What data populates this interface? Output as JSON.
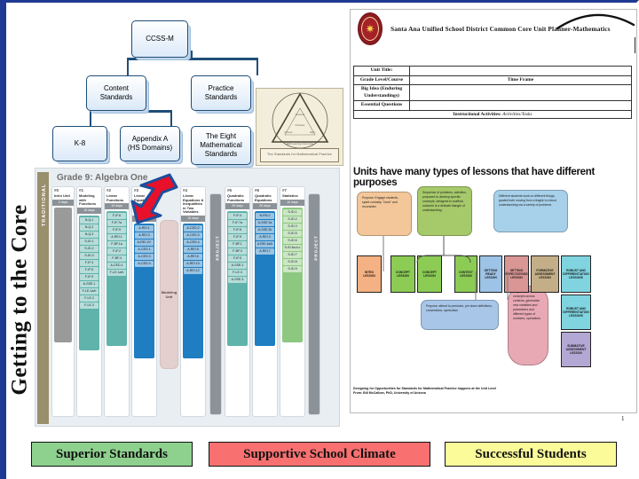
{
  "slide": {
    "core_label": "Getting to the Core"
  },
  "hierarchy": {
    "nodes": [
      {
        "label": "CCSS-M"
      },
      {
        "label": "Content\nStandards"
      },
      {
        "label": "Practice\nStandards"
      },
      {
        "label": "K-8"
      },
      {
        "label": "Appendix A\n(HS Domains)"
      },
      {
        "label": "The Eight\nMathematical\nStandards"
      }
    ]
  },
  "triangle_logo": {
    "caption": "The Standards for Mathematical Practice",
    "inner_labels": [
      "Content",
      "Practices",
      "Process",
      "Proficiency",
      "Math Learning Community"
    ]
  },
  "pathway": {
    "track_label": "TRADITIONAL",
    "title": "Grade 9: Algebra One",
    "columns": [
      {
        "num": "#0",
        "name": "Intro Unit",
        "days": "3 days",
        "color": "#9a9a9a",
        "cells": []
      },
      {
        "num": "#1",
        "name": "Modeling with Functions",
        "days": "15 days",
        "color": "#5fb3ab",
        "cells": [
          "N-Q.1",
          "N-Q.2",
          "N-Q.3",
          "S-ID.1",
          "S-ID.2",
          "S-ID.3",
          "F-IF.4",
          "F-IF.5",
          "F-IF.9",
          "A-SSE.1",
          "F-LE.1a/b",
          "F-LE.2",
          "F-LE.3"
        ]
      },
      {
        "num": "#2",
        "name": "Linear Functions",
        "days": "15 days",
        "color": "#5fb3ab",
        "cells": [
          "F-IF.6",
          "F-IF.7a",
          "F-IF.9",
          "A-REI.1",
          "F-BF.1a",
          "F-IF.2",
          "F-BF.4",
          "A-CED.1",
          "F-LE.1a/b"
        ]
      },
      {
        "num": "#3",
        "name": "Linear Equations & Inequalities in One Variable",
        "days": "15 days",
        "color": "#1f7dc2",
        "cells": [
          "A-REI.1",
          "A-REI.3",
          "A-REI.11*",
          "A-CED.1",
          "A-CED.3",
          "A-CED.4"
        ]
      },
      {
        "num": "",
        "name": "Modeling Unit",
        "days": "4 days",
        "color": "#e3cfcd",
        "cells": []
      },
      {
        "num": "#4",
        "name": "Linear Equations & Inequalities in Two Variables",
        "days": "15 days",
        "color": "#1f7dc2",
        "cells": [
          "A-CED.2",
          "A-CED.3",
          "A-CED.4",
          "A-REI.5",
          "A-REI.6",
          "A-REI.10",
          "A-REI.12"
        ]
      },
      {
        "num": "P",
        "name": "PROJECT",
        "days": "5 days",
        "color": "#8c9398",
        "cells": []
      },
      {
        "num": "#5",
        "name": "Quadratic Functions",
        "days": "20 days",
        "color": "#5fb3ab",
        "cells": [
          "F-IF.4",
          "F-IF.7a",
          "F-IF.8",
          "F-IF.9",
          "F-BF.1",
          "F-BF.3",
          "F-IF.5",
          "A-SSE.1",
          "F-LE.3",
          "A-SSE.3"
        ]
      },
      {
        "num": "#6",
        "name": "Quadratic Equations",
        "days": "20 days",
        "color": "#1f7dc2",
        "cells": [
          "N-RN.2",
          "A-SSE.3a",
          "A-SSE.3b",
          "A-REI.4",
          "A-REI.4a/b",
          "A-REI.7"
        ]
      },
      {
        "num": "#7",
        "name": "Statistics",
        "days": "10 days",
        "color": "#8cc87f",
        "cells": [
          "S-ID.1",
          "S-ID.2",
          "S-ID.3",
          "S-ID.5",
          "S-ID.6",
          "S-ID.6a,b,c",
          "S-ID.7",
          "S-ID.8",
          "S-ID.9"
        ]
      },
      {
        "num": "P",
        "name": "PROJECT",
        "days": "5 days",
        "color": "#8c9398",
        "cells": []
      }
    ]
  },
  "document": {
    "title": "Santa Ana Unified School District Common Core Unit Planner-Mathematics",
    "page_number": "1",
    "form_rows": [
      {
        "label": "Unit Title:",
        "value": ""
      },
      {
        "label": "Grade Level/Course",
        "value": "Time Frame"
      },
      {
        "label": "Big Idea (Enduring Understandings)",
        "value": ""
      },
      {
        "label": "Essential Questions",
        "value": ""
      }
    ],
    "instructional_row": "Instructional Activities:",
    "instructional_row_italic": "Activities/Tasks",
    "purposes": {
      "title": "Units have many types of lessons that have different purposes",
      "callouts": [
        {
          "text": "Purpose: Engage students, spark curiosity, \"hook\" and reconsider",
          "color": "#f3c79a"
        },
        {
          "text": "Sequence of problems, activities, purposed to develop specific concepts, designed to scaffold, outcome is a delicate triangle of understanding",
          "color": "#a6c96a"
        },
        {
          "text": "Different students work on different things, graded both moving from a fragile to robust understanding via a variety of problems",
          "color": "#a7d0ea"
        },
        {
          "text": "Purpose: attend to precision, pin down definitions, conventions, symbolism",
          "color": "#a7c6e8"
        },
        {
          "text": "Purpose: use concepts across contexts, generalize new variables and parameters and different types of numbers, operations",
          "color": "#e8a9b4"
        }
      ],
      "lesson_boxes": [
        {
          "label": "INTRO LESSON",
          "color": "#f4b183"
        },
        {
          "label": "CONCEPT LESSON",
          "color": "#8ccc55"
        },
        {
          "label": "CONCEPT LESSON",
          "color": "#8ccc55"
        },
        {
          "label": "CONTEXT LESSON",
          "color": "#8ccc55"
        },
        {
          "label": "GETTING READY LESSON",
          "color": "#9dc3e6"
        },
        {
          "label": "SETTING EXPECTATIONS LESSON",
          "color": "#d99694"
        },
        {
          "label": "FORMATIVE ASSESSMENT LESSON",
          "color": "#c4ae87"
        },
        {
          "label": "ROBUST AND DIFFERENTIATION LESSONS",
          "color": "#7fd4e0"
        },
        {
          "label": "ROBUST AND DIFFERENTIATION LESSONS",
          "color": "#7fd4e0"
        },
        {
          "label": "SUMMATIVE ASSESSMENT LESSON",
          "color": "#b3a7d4"
        }
      ]
    },
    "credit": "Designing for Opportunities for Standards for Mathematical Practice happens at the Unit Level\nFrom: Bill McCallum, PhD, University of Arizona"
  },
  "footer": {
    "banners": [
      {
        "label": "Superior Standards",
        "color": "#8ed18e"
      },
      {
        "label": "Supportive School Climate",
        "color": "#f97070"
      },
      {
        "label": "Successful Students",
        "color": "#fbfb9a"
      }
    ]
  }
}
